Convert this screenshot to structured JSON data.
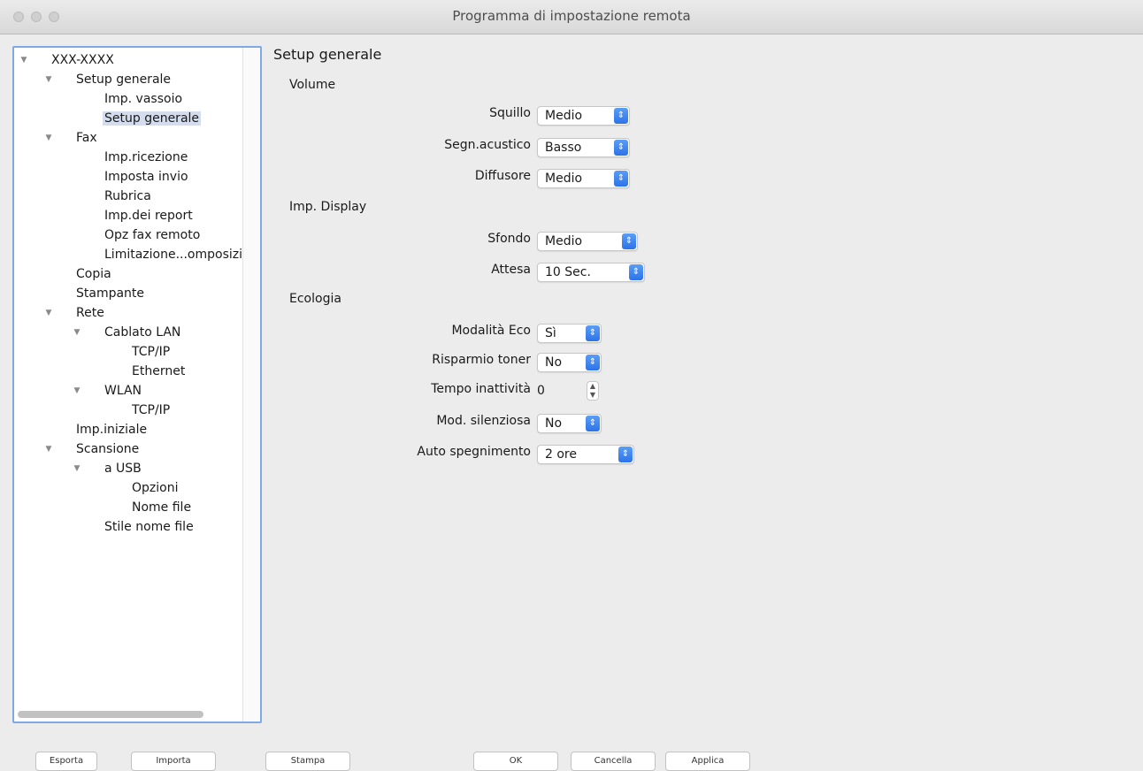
{
  "window": {
    "title": "Programma di impostazione remota"
  },
  "tree": {
    "items": [
      {
        "label": "XXX-XXXX",
        "expanded": true
      },
      {
        "label": "Setup generale",
        "expanded": true
      },
      {
        "label": "Imp. vassoio"
      },
      {
        "label": "Setup generale",
        "selected": true
      },
      {
        "label": "Fax",
        "expanded": true
      },
      {
        "label": "Imp.ricezione"
      },
      {
        "label": "Imposta invio"
      },
      {
        "label": "Rubrica"
      },
      {
        "label": "Imp.dei report"
      },
      {
        "label": "Opz fax remoto"
      },
      {
        "label": "Limitazione...omposizi"
      },
      {
        "label": "Copia"
      },
      {
        "label": "Stampante"
      },
      {
        "label": "Rete",
        "expanded": true
      },
      {
        "label": "Cablato LAN",
        "expanded": true
      },
      {
        "label": "TCP/IP"
      },
      {
        "label": "Ethernet"
      },
      {
        "label": "WLAN",
        "expanded": true
      },
      {
        "label": "TCP/IP"
      },
      {
        "label": "Imp.iniziale"
      },
      {
        "label": "Scansione",
        "expanded": true
      },
      {
        "label": "a USB",
        "expanded": true
      },
      {
        "label": "Opzioni"
      },
      {
        "label": "Nome file"
      },
      {
        "label": "Stile nome file"
      }
    ]
  },
  "content": {
    "section_title": "Setup generale",
    "groups": {
      "volume": "Volume",
      "display": "Imp. Display",
      "ecologia": "Ecologia"
    },
    "fields": {
      "squillo": {
        "label": "Squillo",
        "value": "Medio"
      },
      "segn_acustico": {
        "label": "Segn.acustico",
        "value": "Basso"
      },
      "diffusore": {
        "label": "Diffusore",
        "value": "Medio"
      },
      "sfondo": {
        "label": "Sfondo",
        "value": "Medio"
      },
      "attesa": {
        "label": "Attesa",
        "value": "10 Sec."
      },
      "modalita_eco": {
        "label": "Modalità Eco",
        "value": "Sì"
      },
      "risparmio_toner": {
        "label": "Risparmio toner",
        "value": "No"
      },
      "tempo_inattivita": {
        "label": "Tempo inattività",
        "value": "0"
      },
      "mod_silenziosa": {
        "label": "Mod. silenziosa",
        "value": "No"
      },
      "auto_spegnimento": {
        "label": "Auto spegnimento",
        "value": "2 ore"
      }
    }
  },
  "buttons": {
    "esporta": "Esporta",
    "importa": "Importa",
    "stampa": "Stampa",
    "ok": "OK",
    "cancella": "Cancella",
    "applica": "Applica"
  },
  "colors": {
    "accent": "#2c73e8",
    "selection": "#d3ddee",
    "focus_ring": "#7ea9e3"
  }
}
